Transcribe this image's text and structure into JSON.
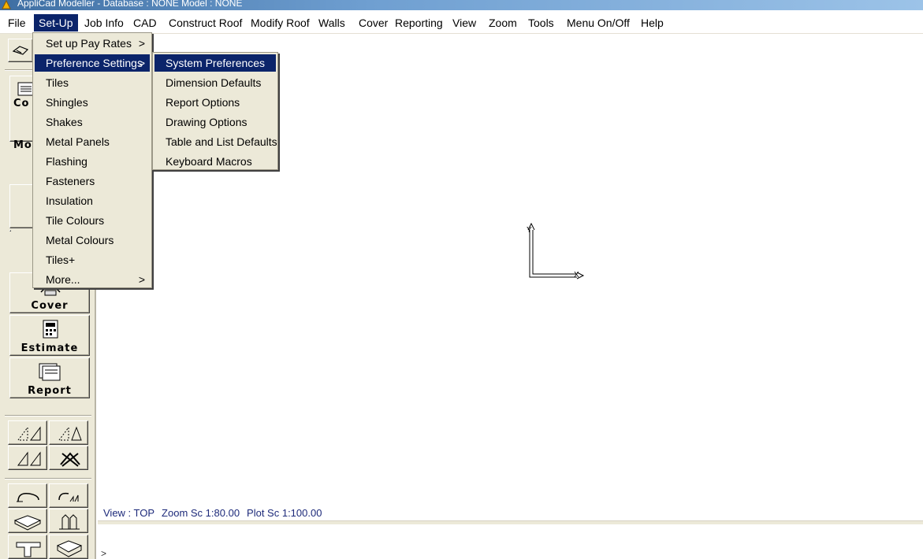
{
  "window": {
    "title": "AppliCad Modeller - Database : NONE   Model : NONE"
  },
  "menubar": {
    "items": [
      {
        "label": "File"
      },
      {
        "label": "Set-Up"
      },
      {
        "label": "Job Info"
      },
      {
        "label": "CAD"
      },
      {
        "label": "Construct Roof"
      },
      {
        "label": "Modify Roof"
      },
      {
        "label": "Walls"
      },
      {
        "label": "Cover"
      },
      {
        "label": "Reporting"
      },
      {
        "label": "View"
      },
      {
        "label": "Zoom"
      },
      {
        "label": "Tools"
      },
      {
        "label": "Menu On/Off"
      },
      {
        "label": "Help"
      }
    ]
  },
  "setup_menu": {
    "items": [
      {
        "label": "Set up Pay Rates",
        "submenu": ">"
      },
      {
        "label": "Preference Settings",
        "submenu": ">"
      },
      {
        "label": "Tiles"
      },
      {
        "label": "Shingles"
      },
      {
        "label": "Shakes"
      },
      {
        "label": "Metal Panels"
      },
      {
        "label": "Flashing"
      },
      {
        "label": "Fasteners"
      },
      {
        "label": "Insulation"
      },
      {
        "label": "Tile Colours"
      },
      {
        "label": "Metal Colours"
      },
      {
        "label": "Tiles+"
      },
      {
        "label": "More...",
        "submenu": ">"
      }
    ]
  },
  "preference_menu": {
    "items": [
      {
        "label": "System Preferences"
      },
      {
        "label": "Dimension Defaults"
      },
      {
        "label": "Report Options"
      },
      {
        "label": "Drawing Options"
      },
      {
        "label": "Table and List Defaults"
      },
      {
        "label": "Keyboard Macros"
      }
    ]
  },
  "toolbar": {
    "cover_label": "Cover",
    "estimate_label": "Estimate",
    "report_label": "Report",
    "construct_partial": "Co",
    "modify_partial": "Mo"
  },
  "canvas": {
    "axis_x_label": "X",
    "axis_y_label": "Y"
  },
  "status": {
    "view": "View : TOP",
    "zoom": "Zoom Sc 1:80.00",
    "plot": "Plot Sc 1:100.00"
  },
  "command": {
    "prompt": ">"
  },
  "colors": {
    "menu_highlight": "#0b246a",
    "panel_bg": "#ece9d8",
    "status_text": "#1d2a7a"
  }
}
